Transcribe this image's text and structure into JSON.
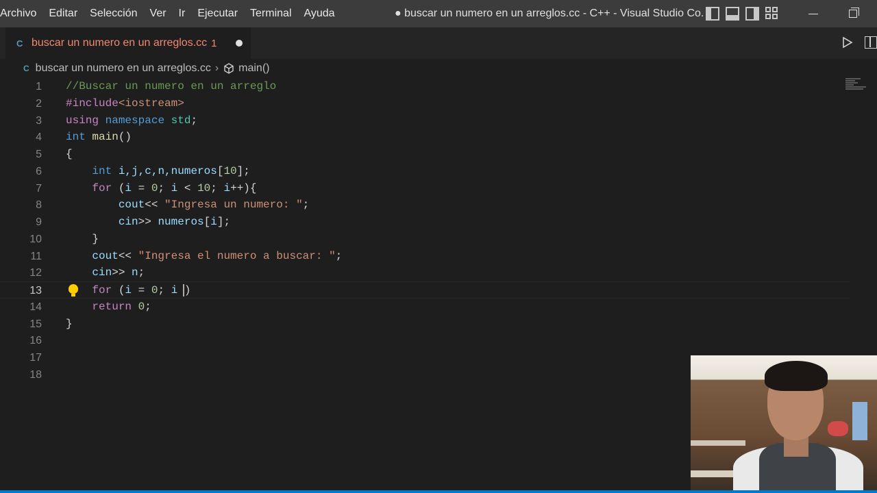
{
  "menu": [
    "Archivo",
    "Editar",
    "Selección",
    "Ver",
    "Ir",
    "Ejecutar",
    "Terminal",
    "Ayuda"
  ],
  "window_title": "● buscar un numero en un arreglos.cc - C++ - Visual Studio Co...",
  "tab": {
    "icon": "C",
    "label": "buscar un numero en un arreglos.cc",
    "problems": "1",
    "modified": true
  },
  "breadcrumb": {
    "file": "buscar un numero en un arreglos.cc",
    "symbol": "main()"
  },
  "editor": {
    "current_line": 13,
    "lines": [
      {
        "n": "1",
        "tokens": [
          {
            "t": "//Buscar un numero en un arreglo",
            "c": "#6a9955"
          }
        ]
      },
      {
        "n": "2",
        "tokens": [
          {
            "t": "#include",
            "c": "#c586c0"
          },
          {
            "t": "<iostream>",
            "c": "#ce9178"
          }
        ]
      },
      {
        "n": "3",
        "tokens": [
          {
            "t": "using",
            "c": "#c586c0"
          },
          {
            "t": " ",
            "c": "#d4d4d4"
          },
          {
            "t": "namespace",
            "c": "#569cd6"
          },
          {
            "t": " ",
            "c": "#d4d4d4"
          },
          {
            "t": "std",
            "c": "#4ec9b0"
          },
          {
            "t": ";",
            "c": "#d4d4d4"
          }
        ]
      },
      {
        "n": "4",
        "tokens": [
          {
            "t": "int",
            "c": "#569cd6"
          },
          {
            "t": " ",
            "c": "#d4d4d4"
          },
          {
            "t": "main",
            "c": "#dcdcaa"
          },
          {
            "t": "()",
            "c": "#d4d4d4"
          }
        ]
      },
      {
        "n": "5",
        "tokens": [
          {
            "t": "{",
            "c": "#d4d4d4"
          }
        ]
      },
      {
        "n": "6",
        "tokens": [
          {
            "t": "    ",
            "c": "#d4d4d4"
          },
          {
            "t": "int",
            "c": "#569cd6"
          },
          {
            "t": " ",
            "c": "#d4d4d4"
          },
          {
            "t": "i,j,c,n,numeros",
            "c": "#9cdcfe"
          },
          {
            "t": "[",
            "c": "#d4d4d4"
          },
          {
            "t": "10",
            "c": "#b5cea8"
          },
          {
            "t": "];",
            "c": "#d4d4d4"
          }
        ]
      },
      {
        "n": "7",
        "tokens": [
          {
            "t": "    ",
            "c": "#d4d4d4"
          },
          {
            "t": "for",
            "c": "#c586c0"
          },
          {
            "t": " (",
            "c": "#d4d4d4"
          },
          {
            "t": "i",
            "c": "#9cdcfe"
          },
          {
            "t": " = ",
            "c": "#d4d4d4"
          },
          {
            "t": "0",
            "c": "#b5cea8"
          },
          {
            "t": "; ",
            "c": "#d4d4d4"
          },
          {
            "t": "i",
            "c": "#9cdcfe"
          },
          {
            "t": " < ",
            "c": "#d4d4d4"
          },
          {
            "t": "10",
            "c": "#b5cea8"
          },
          {
            "t": "; ",
            "c": "#d4d4d4"
          },
          {
            "t": "i",
            "c": "#9cdcfe"
          },
          {
            "t": "++){",
            "c": "#d4d4d4"
          }
        ]
      },
      {
        "n": "8",
        "tokens": [
          {
            "t": "        ",
            "c": "#d4d4d4"
          },
          {
            "t": "cout",
            "c": "#9cdcfe"
          },
          {
            "t": "<< ",
            "c": "#d4d4d4"
          },
          {
            "t": "\"Ingresa un numero: \"",
            "c": "#ce9178"
          },
          {
            "t": ";",
            "c": "#d4d4d4"
          }
        ]
      },
      {
        "n": "9",
        "tokens": [
          {
            "t": "        ",
            "c": "#d4d4d4"
          },
          {
            "t": "cin",
            "c": "#9cdcfe"
          },
          {
            "t": ">> ",
            "c": "#d4d4d4"
          },
          {
            "t": "numeros",
            "c": "#9cdcfe"
          },
          {
            "t": "[",
            "c": "#d4d4d4"
          },
          {
            "t": "i",
            "c": "#9cdcfe"
          },
          {
            "t": "];",
            "c": "#d4d4d4"
          }
        ]
      },
      {
        "n": "10",
        "tokens": [
          {
            "t": "    }",
            "c": "#d4d4d4"
          }
        ]
      },
      {
        "n": "11",
        "tokens": [
          {
            "t": "    ",
            "c": "#d4d4d4"
          },
          {
            "t": "cout",
            "c": "#9cdcfe"
          },
          {
            "t": "<< ",
            "c": "#d4d4d4"
          },
          {
            "t": "\"Ingresa el numero a buscar: \"",
            "c": "#ce9178"
          },
          {
            "t": ";",
            "c": "#d4d4d4"
          }
        ]
      },
      {
        "n": "12",
        "tokens": [
          {
            "t": "    ",
            "c": "#d4d4d4"
          },
          {
            "t": "cin",
            "c": "#9cdcfe"
          },
          {
            "t": ">> ",
            "c": "#d4d4d4"
          },
          {
            "t": "n",
            "c": "#9cdcfe"
          },
          {
            "t": ";",
            "c": "#d4d4d4"
          }
        ]
      },
      {
        "n": "13",
        "tokens": [
          {
            "t": "    ",
            "c": "#d4d4d4"
          },
          {
            "t": "for",
            "c": "#c586c0"
          },
          {
            "t": " (",
            "c": "#d4d4d4"
          },
          {
            "t": "i",
            "c": "#9cdcfe"
          },
          {
            "t": " = ",
            "c": "#d4d4d4"
          },
          {
            "t": "0",
            "c": "#b5cea8"
          },
          {
            "t": "; ",
            "c": "#d4d4d4"
          },
          {
            "t": "i",
            "c": "#9cdcfe"
          },
          {
            "t": " ",
            "c": "#d4d4d4"
          },
          {
            "t": "|cursor|",
            "c": "cursor"
          },
          {
            "t": ")",
            "c": "#d4d4d4"
          }
        ]
      },
      {
        "n": "14",
        "tokens": [
          {
            "t": "    ",
            "c": "#d4d4d4"
          },
          {
            "t": "return",
            "c": "#c586c0"
          },
          {
            "t": " ",
            "c": "#d4d4d4"
          },
          {
            "t": "0",
            "c": "#b5cea8"
          },
          {
            "t": ";",
            "c": "#d4d4d4"
          }
        ]
      },
      {
        "n": "15",
        "tokens": [
          {
            "t": "}",
            "c": "#d4d4d4"
          }
        ]
      },
      {
        "n": "16",
        "tokens": []
      },
      {
        "n": "17",
        "tokens": []
      },
      {
        "n": "18",
        "tokens": []
      }
    ]
  },
  "icons": {
    "tab_file": "cpp-file-icon",
    "run": "play-icon",
    "split": "split-editor-icon",
    "symbol": "cube-symbol-icon",
    "hint": "lightbulb-icon"
  },
  "colors": {
    "accent": "#007acc",
    "error_tab": "#f48771",
    "background": "#1e1e1e"
  }
}
